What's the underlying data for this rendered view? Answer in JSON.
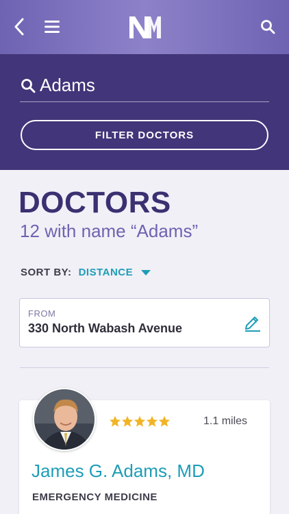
{
  "header": {
    "back_icon": "chevron-left-icon",
    "menu_icon": "hamburger-menu-icon",
    "logo_icon": "nm-logo-icon",
    "search_icon": "search-icon"
  },
  "search": {
    "value": "Adams",
    "filter_label": "FILTER DOCTORS"
  },
  "results": {
    "title": "DOCTORS",
    "subtitle": "12 with name “Adams”"
  },
  "sort": {
    "label": "SORT BY:",
    "value": "DISTANCE"
  },
  "from": {
    "label": "FROM",
    "address": "330 North Wabash Avenue"
  },
  "doctors": [
    {
      "name": "James G. Adams, MD",
      "specialty": "EMERGENCY MEDICINE",
      "rating": 5,
      "distance": "1.1 miles"
    }
  ],
  "colors": {
    "header": "#7a6fbf",
    "panel": "#423579",
    "accent": "#1d9db7",
    "title": "#3b3071",
    "star": "#f2b424"
  }
}
